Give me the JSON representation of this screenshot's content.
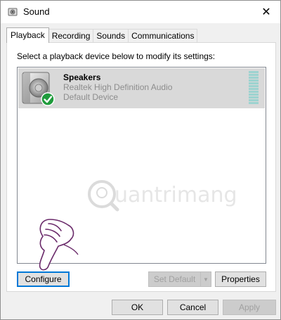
{
  "window": {
    "title": "Sound",
    "close_glyph": "✕"
  },
  "tabs": [
    {
      "label": "Playback",
      "active": true
    },
    {
      "label": "Recording",
      "active": false
    },
    {
      "label": "Sounds",
      "active": false
    },
    {
      "label": "Communications",
      "active": false
    }
  ],
  "playback": {
    "instruction": "Select a playback device below to modify its settings:",
    "devices": [
      {
        "name": "Speakers",
        "description": "Realtek High Definition Audio",
        "status": "Default Device",
        "icon": "speaker-icon",
        "badge_icon": "default-check-icon",
        "level_fraction": 0
      }
    ]
  },
  "watermark": {
    "text": "uantrimang"
  },
  "buttons": {
    "configure": "Configure",
    "set_default": "Set Default",
    "properties": "Properties",
    "ok": "OK",
    "cancel": "Cancel",
    "apply": "Apply"
  },
  "colors": {
    "selected_row": "#d9d9d9",
    "meter": "#9dd3d0",
    "check_green": "#1f9b3c",
    "focus_border": "#0078d7"
  }
}
